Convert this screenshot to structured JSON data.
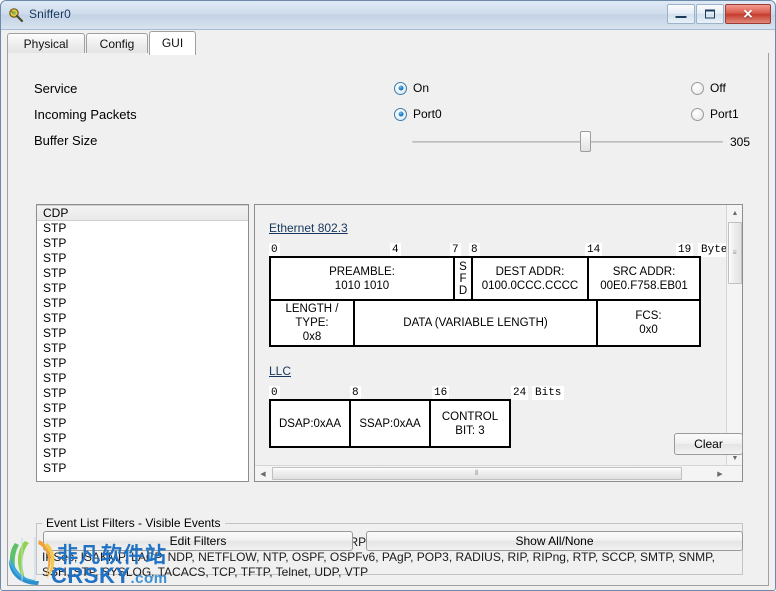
{
  "window": {
    "title": "Sniffer0",
    "icon": "sniffer-icon",
    "minimize_label": "Minimize",
    "maximize_label": "Maximize",
    "close_label": "✕"
  },
  "tabs": [
    {
      "label": "Physical",
      "active": false
    },
    {
      "label": "Config",
      "active": false
    },
    {
      "label": "GUI",
      "active": true
    }
  ],
  "settings": {
    "service": {
      "label": "Service",
      "options": [
        {
          "label": "On",
          "selected": true
        },
        {
          "label": "Off",
          "selected": false
        }
      ]
    },
    "incoming_packets": {
      "label": "Incoming Packets",
      "options": [
        {
          "label": "Port0",
          "selected": true
        },
        {
          "label": "Port1",
          "selected": false
        }
      ]
    },
    "buffer_size": {
      "label": "Buffer Size",
      "value": "305",
      "percent": 48
    }
  },
  "packet_list": {
    "items": [
      {
        "label": "CDP",
        "selected": true
      },
      {
        "label": "STP",
        "selected": false
      },
      {
        "label": "STP",
        "selected": false
      },
      {
        "label": "STP",
        "selected": false
      },
      {
        "label": "STP",
        "selected": false
      },
      {
        "label": "STP",
        "selected": false
      },
      {
        "label": "STP",
        "selected": false
      },
      {
        "label": "STP",
        "selected": false
      },
      {
        "label": "STP",
        "selected": false
      },
      {
        "label": "STP",
        "selected": false
      },
      {
        "label": "STP",
        "selected": false
      },
      {
        "label": "STP",
        "selected": false
      },
      {
        "label": "STP",
        "selected": false
      },
      {
        "label": "STP",
        "selected": false
      },
      {
        "label": "STP",
        "selected": false
      },
      {
        "label": "STP",
        "selected": false
      },
      {
        "label": "STP",
        "selected": false
      },
      {
        "label": "STP",
        "selected": false
      }
    ]
  },
  "diagram": {
    "ethernet": {
      "title": "Ethernet 802.3",
      "unit": "Bytes",
      "marks": [
        "0",
        "4",
        "7",
        "8",
        "14",
        "19"
      ],
      "row1": [
        {
          "name": "preamble",
          "text": "PREAMBLE:\n1010 1010"
        },
        {
          "name": "sfd",
          "text": "S\nF\nD"
        },
        {
          "name": "dest-addr",
          "text": "DEST ADDR:\n0100.0CCC.CCCC"
        },
        {
          "name": "src-addr",
          "text": "SRC ADDR:\n00E0.F758.EB01"
        }
      ],
      "row2": [
        {
          "name": "length-type",
          "text": "LENGTH /\nTYPE:\n0x8"
        },
        {
          "name": "data",
          "text": "DATA (VARIABLE LENGTH)"
        },
        {
          "name": "fcs",
          "text": "FCS:\n0x0"
        }
      ]
    },
    "llc": {
      "title": "LLC",
      "unit": "Bits",
      "marks": [
        "0",
        "8",
        "16",
        "24"
      ],
      "fields": [
        {
          "name": "dsap",
          "text": "DSAP:0xAA"
        },
        {
          "name": "ssap",
          "text": "SSAP:0xAA"
        },
        {
          "name": "control",
          "text": "CONTROL\nBIT: 3"
        }
      ]
    }
  },
  "actions": {
    "clear": "Clear",
    "edit_filters": "Edit Filters",
    "show_all_none": "Show All/None"
  },
  "filters": {
    "title": "Event List Filters - Visible Events",
    "events": "ARP, BGP, CDP, DHCP, DHCPv6, DNS, DTP, EIGRP, EIGRPv6, FTP, H.323, HSRP, HSRPv6, HTTP, HTTPS, ICMP, ICMPv6,\nIPSec, ISAKMP, LACP, NDP, NETFLOW, NTP, OSPF, OSPFv6, PAgP, POP3, RADIUS, RIP, RIPng, RTP, SCCP, SMTP, SNMP,\nSSH, STP, SYSLOG, TACACS, TCP, TFTP, Telnet, UDP, VTP"
  },
  "watermark": {
    "cn": "非凡软件站",
    "en": "CRSKY",
    "tld": ".com"
  },
  "colors": {
    "accent": "#1d78c0",
    "title_text": "#17385e",
    "link": "#17365d",
    "watermark": "#1f72c4"
  }
}
